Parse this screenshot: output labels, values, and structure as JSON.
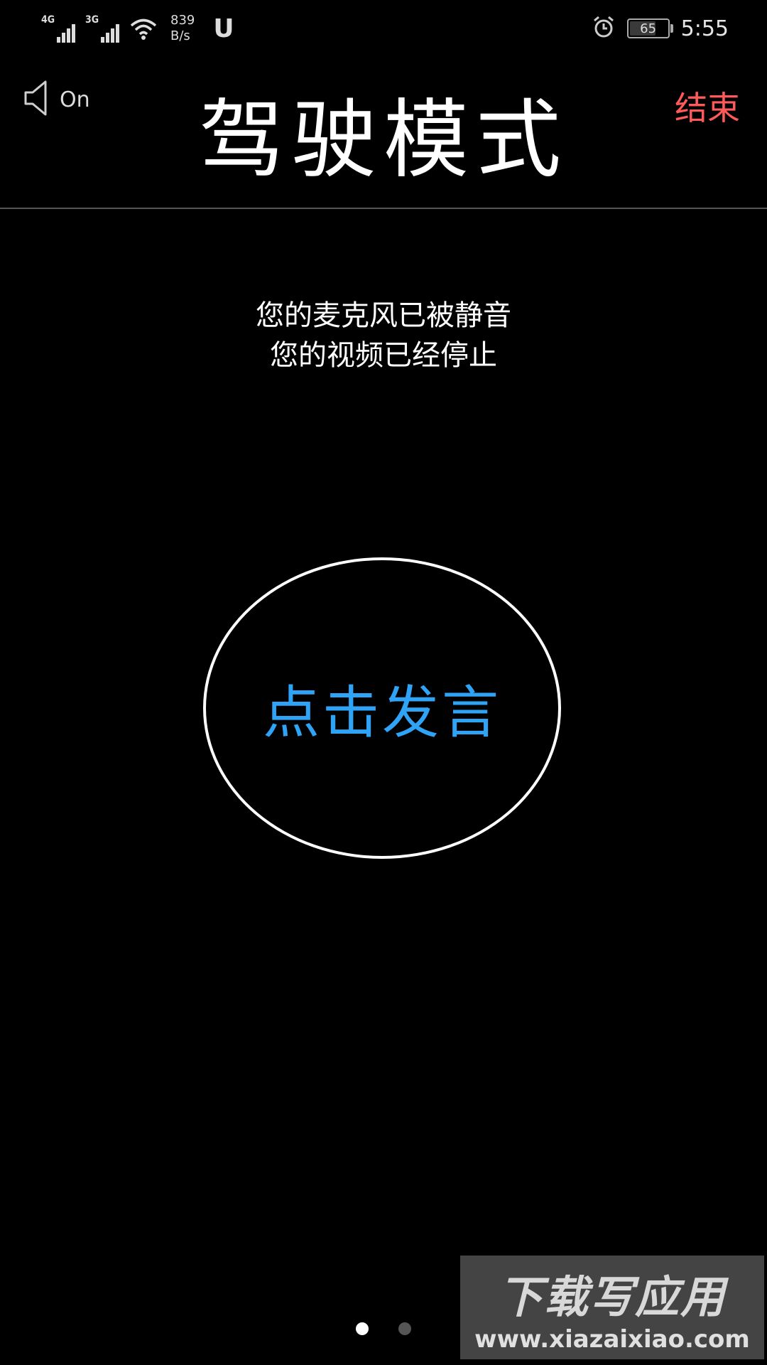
{
  "status_bar": {
    "signal_1_label": "4G",
    "signal_2_label": "3G",
    "net_speed_value": "839",
    "net_speed_unit": "B/s",
    "app_icon_letter": "U",
    "battery_level": "65",
    "time": "5:55"
  },
  "header": {
    "speaker_status": "On",
    "title": "驾驶模式",
    "end_label": "结束"
  },
  "status_messages": [
    "您的麦克风已被静音",
    "您的视频已经停止"
  ],
  "speak_button_label": "点击发言",
  "pager": {
    "pages": 2,
    "active_index": 0
  },
  "watermark": {
    "title": "下载写应用",
    "url": "www.xiazaixiao.com"
  },
  "colors": {
    "background": "#000000",
    "end_text": "#ff5a5a",
    "speak_text": "#2fa3f6"
  }
}
